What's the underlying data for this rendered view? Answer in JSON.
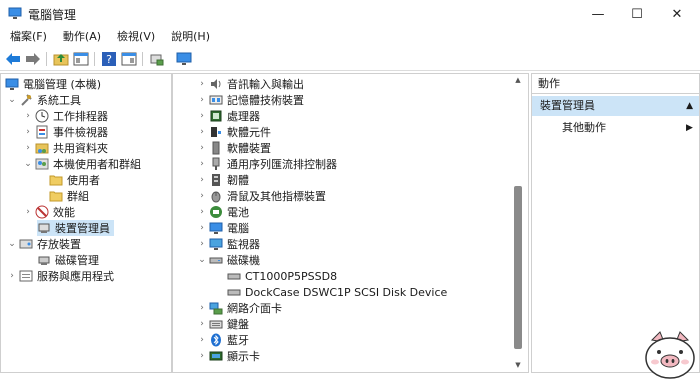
{
  "window": {
    "title": "電腦管理",
    "minimize": "—",
    "maximize": "☐",
    "close": "✕"
  },
  "menu": [
    "檔案(F)",
    "動作(A)",
    "檢視(V)",
    "說明(H)"
  ],
  "tree": [
    {
      "label": "電腦管理 (本機)",
      "chev": "",
      "icon": "computer-mgmt-icon"
    },
    {
      "label": "系統工具",
      "chev": "⌄",
      "icon": "tools-icon"
    },
    {
      "label": "工作排程器",
      "chev": "›",
      "icon": "clock-icon"
    },
    {
      "label": "事件檢視器",
      "chev": "›",
      "icon": "event-viewer-icon"
    },
    {
      "label": "共用資料夾",
      "chev": "›",
      "icon": "shared-folder-icon"
    },
    {
      "label": "本機使用者和群組",
      "chev": "⌄",
      "icon": "users-groups-icon"
    },
    {
      "label": "使用者",
      "chev": "",
      "icon": "folder-icon"
    },
    {
      "label": "群組",
      "chev": "",
      "icon": "folder-icon"
    },
    {
      "label": "效能",
      "chev": "›",
      "icon": "performance-icon"
    },
    {
      "label": "裝置管理員",
      "chev": "",
      "icon": "device-manager-icon"
    },
    {
      "label": "存放裝置",
      "chev": "⌄",
      "icon": "storage-icon"
    },
    {
      "label": "磁碟管理",
      "chev": "",
      "icon": "disk-management-icon"
    },
    {
      "label": "服務與應用程式",
      "chev": "›",
      "icon": "services-icon"
    }
  ],
  "devices": [
    {
      "label": "音訊輸入與輸出",
      "chev": "›",
      "icon": "speaker-icon"
    },
    {
      "label": "記憶體技術裝置",
      "chev": "›",
      "icon": "memory-icon"
    },
    {
      "label": "處理器",
      "chev": "›",
      "icon": "processor-icon"
    },
    {
      "label": "軟體元件",
      "chev": "›",
      "icon": "software-component-icon"
    },
    {
      "label": "軟體裝置",
      "chev": "›",
      "icon": "software-device-icon"
    },
    {
      "label": "通用序列匯流排控制器",
      "chev": "›",
      "icon": "usb-icon"
    },
    {
      "label": "韌體",
      "chev": "›",
      "icon": "firmware-icon"
    },
    {
      "label": "滑鼠及其他指標裝置",
      "chev": "›",
      "icon": "mouse-icon"
    },
    {
      "label": "電池",
      "chev": "›",
      "icon": "battery-icon"
    },
    {
      "label": "電腦",
      "chev": "›",
      "icon": "computer-icon"
    },
    {
      "label": "監視器",
      "chev": "›",
      "icon": "monitor-icon"
    },
    {
      "label": "磁碟機",
      "chev": "⌄",
      "icon": "disk-drive-icon"
    },
    {
      "label": "CT1000P5PSSD8",
      "chev": "",
      "icon": "disk-icon"
    },
    {
      "label": "DockCase DSWC1P SCSI Disk Device",
      "chev": "",
      "icon": "disk-icon"
    },
    {
      "label": "網路介面卡",
      "chev": "›",
      "icon": "network-adapter-icon"
    },
    {
      "label": "鍵盤",
      "chev": "›",
      "icon": "keyboard-icon"
    },
    {
      "label": "藍牙",
      "chev": "›",
      "icon": "bluetooth-icon"
    },
    {
      "label": "顯示卡",
      "chev": "›",
      "icon": "display-adapter-icon"
    }
  ],
  "actions": {
    "header": "動作",
    "group": "裝置管理員",
    "group_arrow": "▲",
    "sub": "其他動作",
    "sub_arrow": "▶"
  },
  "colors": {
    "selected": "#cce4f7",
    "accent": "#0078d4"
  }
}
